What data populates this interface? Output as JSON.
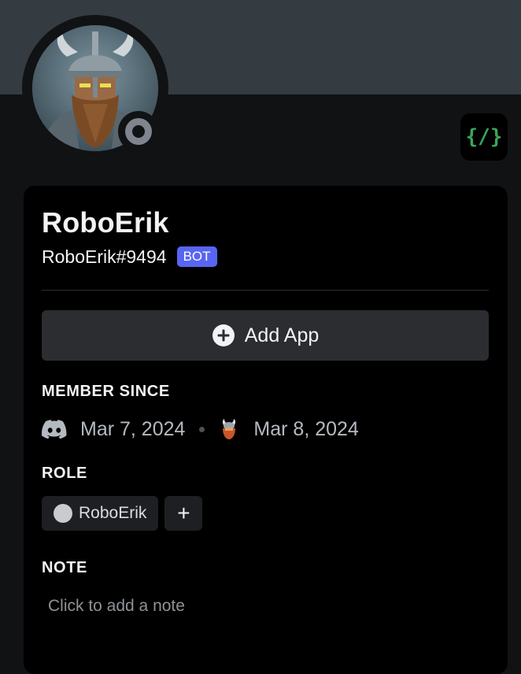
{
  "profile": {
    "display_name": "RoboErik",
    "username": "RoboErik#9494",
    "bot_tag": "BOT",
    "avatar_icon": "viking-robot-avatar",
    "status": "offline"
  },
  "app_badge": {
    "label": "{/}",
    "icon": "slash-commands-icon",
    "color": "#3ba55c"
  },
  "actions": {
    "add_app_label": "Add App"
  },
  "member_since": {
    "title": "MEMBER SINCE",
    "discord_date": "Mar 7, 2024",
    "server_date": "Mar 8, 2024"
  },
  "roles": {
    "title": "ROLE",
    "items": [
      {
        "name": "RoboErik",
        "color": "#c8cbd0"
      }
    ],
    "add_label": "+"
  },
  "note": {
    "title": "NOTE",
    "placeholder": "Click to add a note"
  },
  "colors": {
    "bot_tag": "#5865f2",
    "banner": "#353c41",
    "background": "#111214"
  }
}
